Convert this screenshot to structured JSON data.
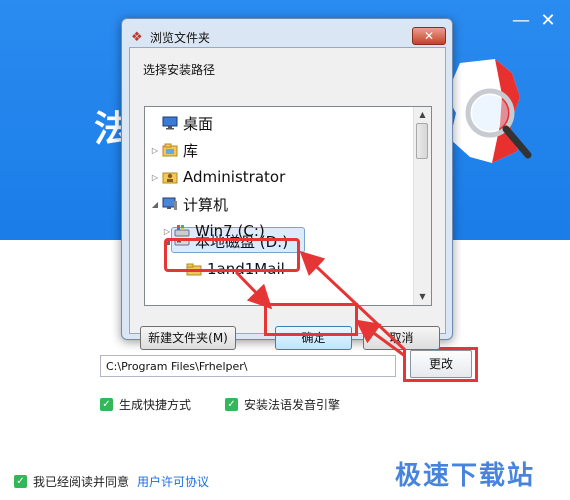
{
  "installer": {
    "banner_title": "法",
    "minimize_label": "—",
    "close_label": "✕",
    "path_value": "C:\\Program Files\\Frhelper\\",
    "change_button": "更改",
    "option_shortcut": "生成快捷方式",
    "option_voice": "安装法语发音引擎",
    "agree_text": "我已经阅读并同意",
    "license_link": "用户许可协议",
    "check_mark": "✓"
  },
  "dialog": {
    "title": "浏览文件夹",
    "close_label": "✕",
    "description": "选择安装路径",
    "tree": [
      {
        "label": "桌面",
        "icon": "desktop-icon",
        "arrow": ""
      },
      {
        "label": "库",
        "icon": "library-icon",
        "arrow": "▷"
      },
      {
        "label": "Administrator",
        "icon": "user-folder-icon",
        "arrow": "▷"
      },
      {
        "label": "计算机",
        "icon": "computer-icon",
        "arrow": "◢"
      },
      {
        "label": "Win7 (C:)",
        "icon": "system-drive-icon",
        "arrow": "▷"
      },
      {
        "label": "本地磁盘 (D:)",
        "icon": "drive-icon",
        "arrow": "◢",
        "selected": true
      },
      {
        "label": "1and1Mail",
        "icon": "folder-icon",
        "arrow": ""
      }
    ],
    "new_folder_button": "新建文件夹(M)",
    "ok_button": "确定",
    "cancel_button": "取消"
  },
  "watermark": {
    "text": "极速下载站"
  },
  "colors": {
    "banner": "#1a7de8",
    "highlight": "#e53535",
    "checkbox": "#34b65a",
    "link": "#1a6fe0"
  }
}
